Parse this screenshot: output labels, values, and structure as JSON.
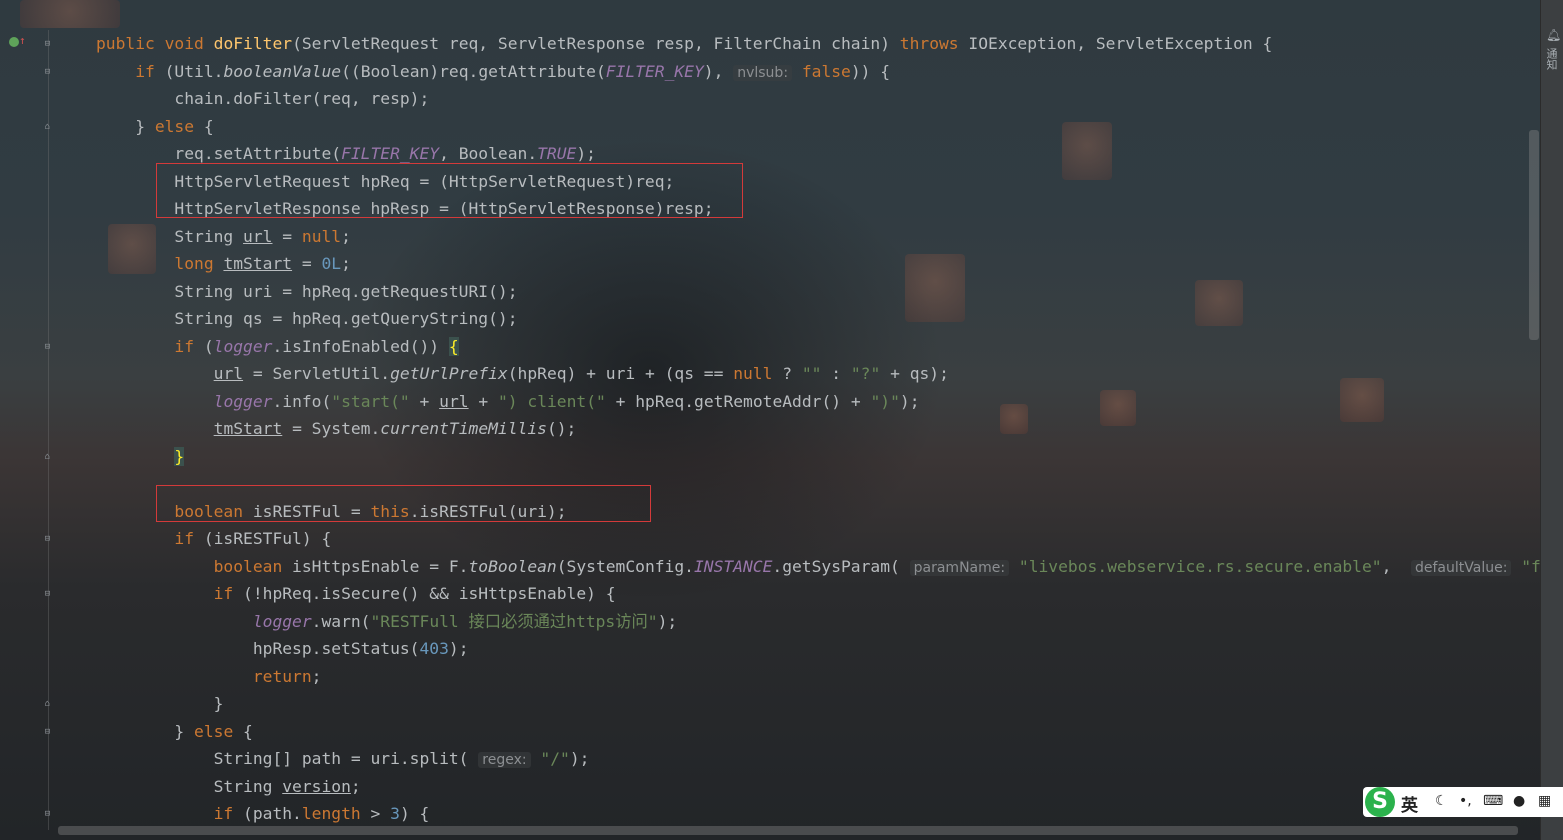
{
  "editor": {
    "lines": [
      {
        "fold": "minus",
        "segs": [
          [
            "kw",
            "public "
          ],
          [
            "kw",
            "void "
          ],
          [
            "fn",
            "doFilter"
          ],
          [
            "",
            "(ServletRequest req, ServletResponse resp, FilterChain chain) "
          ],
          [
            "kw",
            "throws "
          ],
          [
            "",
            "IOException, ServletException {"
          ]
        ]
      },
      {
        "fold": "minus",
        "segs": [
          [
            "kw",
            "    if "
          ],
          [
            "",
            "(Util."
          ],
          [
            "it",
            "booleanValue"
          ],
          [
            "",
            "((Boolean)req.getAttribute("
          ],
          [
            "const",
            "FILTER_KEY"
          ],
          [
            "",
            "), "
          ],
          [
            "hint",
            "nvlsub:"
          ],
          [
            "kw",
            " false"
          ],
          [
            "",
            "))"
          ],
          [
            "",
            " {"
          ]
        ]
      },
      {
        "segs": [
          [
            "",
            "        chain.doFilter(req, resp);"
          ]
        ]
      },
      {
        "fold": "plus",
        "segs": [
          [
            "",
            "    } "
          ],
          [
            "kw",
            "else"
          ],
          [
            "",
            " {"
          ]
        ]
      },
      {
        "segs": [
          [
            "",
            "        req.setAttribute("
          ],
          [
            "const",
            "FILTER_KEY"
          ],
          [
            "",
            ", Boolean."
          ],
          [
            "const",
            "TRUE"
          ],
          [
            "",
            ");"
          ]
        ]
      },
      {
        "segs": [
          [
            "",
            "        HttpServletRequest hpReq = (HttpServletRequest)req;"
          ]
        ]
      },
      {
        "segs": [
          [
            "",
            "        HttpServletResponse hpResp = (HttpServletResponse)resp;"
          ]
        ]
      },
      {
        "segs": [
          [
            "",
            "        String "
          ],
          [
            "ul",
            "url"
          ],
          [
            "",
            " = "
          ],
          [
            "kw",
            "null"
          ],
          [
            "",
            ";"
          ]
        ]
      },
      {
        "segs": [
          [
            "kw",
            "        long "
          ],
          [
            "ul",
            "tmStart"
          ],
          [
            "",
            " = "
          ],
          [
            "num",
            "0L"
          ],
          [
            "",
            ";"
          ]
        ]
      },
      {
        "segs": [
          [
            "",
            "        String uri = hpReq.getRequestURI();"
          ]
        ]
      },
      {
        "segs": [
          [
            "",
            "        String qs = hpReq.getQueryString();"
          ]
        ]
      },
      {
        "fold": "minus",
        "segs": [
          [
            "kw",
            "        if "
          ],
          [
            "",
            "("
          ],
          [
            "const",
            "logger"
          ],
          [
            "",
            ".isInfoEnabled()) "
          ],
          [
            "brace",
            "{"
          ]
        ]
      },
      {
        "segs": [
          [
            "",
            "            "
          ],
          [
            "ul",
            "url"
          ],
          [
            "",
            " = ServletUtil."
          ],
          [
            "it",
            "getUrlPrefix"
          ],
          [
            "",
            "(hpReq) + uri + (qs == "
          ],
          [
            "kw",
            "null"
          ],
          [
            "",
            " ? "
          ],
          [
            "str",
            "\"\""
          ],
          [
            "",
            " : "
          ],
          [
            "str",
            "\"?\""
          ],
          [
            "",
            " + qs);"
          ]
        ]
      },
      {
        "segs": [
          [
            "",
            "            "
          ],
          [
            "const",
            "logger"
          ],
          [
            "",
            ".info("
          ],
          [
            "str",
            "\"start(\""
          ],
          [
            "",
            " + "
          ],
          [
            "ul",
            "url"
          ],
          [
            "",
            " + "
          ],
          [
            "str",
            "\") client(\""
          ],
          [
            "",
            " + hpReq.getRemoteAddr() + "
          ],
          [
            "str",
            "\")\""
          ],
          [
            "",
            ");"
          ]
        ]
      },
      {
        "segs": [
          [
            "",
            "            "
          ],
          [
            "ul",
            "tmStart"
          ],
          [
            "",
            " = System."
          ],
          [
            "it",
            "currentTimeMillis"
          ],
          [
            "",
            "();"
          ]
        ]
      },
      {
        "fold": "plus",
        "segs": [
          [
            "",
            "        "
          ],
          [
            "brace",
            "}"
          ]
        ]
      },
      {
        "segs": [
          [
            "",
            ""
          ]
        ]
      },
      {
        "segs": [
          [
            "kw",
            "        boolean "
          ],
          [
            "",
            "isRESTFul = "
          ],
          [
            "kw",
            "this"
          ],
          [
            "",
            ".isRESTFul(uri);"
          ]
        ]
      },
      {
        "fold": "minus",
        "segs": [
          [
            "kw",
            "        if "
          ],
          [
            "",
            "(isRESTFul) {"
          ]
        ]
      },
      {
        "segs": [
          [
            "kw",
            "            boolean "
          ],
          [
            "",
            "isHttpsEnable = F."
          ],
          [
            "it",
            "toBoolean"
          ],
          [
            "",
            "(SystemConfig."
          ],
          [
            "const",
            "INSTANCE"
          ],
          [
            "",
            ".getSysParam( "
          ],
          [
            "hint",
            "paramName:"
          ],
          [
            "str",
            " \"livebos.webservice.rs.secure.enable\""
          ],
          [
            "",
            ",  "
          ],
          [
            "hint",
            "defaultValue:"
          ],
          [
            "str",
            " \"f"
          ]
        ]
      },
      {
        "fold": "minus",
        "segs": [
          [
            "kw",
            "            if "
          ],
          [
            "",
            "(!hpReq.isSecure() && isHttpsEnable) {"
          ]
        ]
      },
      {
        "segs": [
          [
            "",
            "                "
          ],
          [
            "const",
            "logger"
          ],
          [
            "",
            ".warn("
          ],
          [
            "str",
            "\"RESTFull 接口必须通过https访问\""
          ],
          [
            "",
            ");"
          ]
        ]
      },
      {
        "segs": [
          [
            "",
            "                hpResp.setStatus("
          ],
          [
            "num",
            "403"
          ],
          [
            "",
            ");"
          ]
        ]
      },
      {
        "segs": [
          [
            "kw",
            "                return"
          ],
          [
            "",
            ";"
          ]
        ]
      },
      {
        "fold": "plus",
        "segs": [
          [
            "",
            "            }"
          ]
        ]
      },
      {
        "fold": "minus",
        "segs": [
          [
            "",
            "        } "
          ],
          [
            "kw",
            "else"
          ],
          [
            "",
            " {"
          ]
        ]
      },
      {
        "segs": [
          [
            "",
            "            String[] path = uri.split( "
          ],
          [
            "hint",
            "regex:"
          ],
          [
            "str",
            " \"/\""
          ],
          [
            "",
            ");"
          ]
        ]
      },
      {
        "segs": [
          [
            "",
            "            String "
          ],
          [
            "ul",
            "version"
          ],
          [
            "",
            ";"
          ]
        ]
      },
      {
        "fold": "minus",
        "segs": [
          [
            "kw",
            "            if "
          ],
          [
            "",
            "(path."
          ],
          [
            "kw",
            "length"
          ],
          [
            "",
            " > "
          ],
          [
            "num",
            "3"
          ],
          [
            "",
            ") {"
          ]
        ]
      }
    ]
  },
  "colors": {
    "keyword": "#cc7832",
    "method_decl": "#ffc66d",
    "constant": "#9876aa",
    "string": "#6a8759",
    "number": "#6897bb",
    "highlight_box": "#d33a3a"
  },
  "right_panel": {
    "notify_label": "通知",
    "notify_icon": "bell-icon"
  },
  "ime": {
    "logo": "S",
    "lang": "英",
    "icons": [
      "moon-icon",
      "punctuation-icon",
      "keyboard-icon",
      "user-icon",
      "grid-icon"
    ]
  }
}
